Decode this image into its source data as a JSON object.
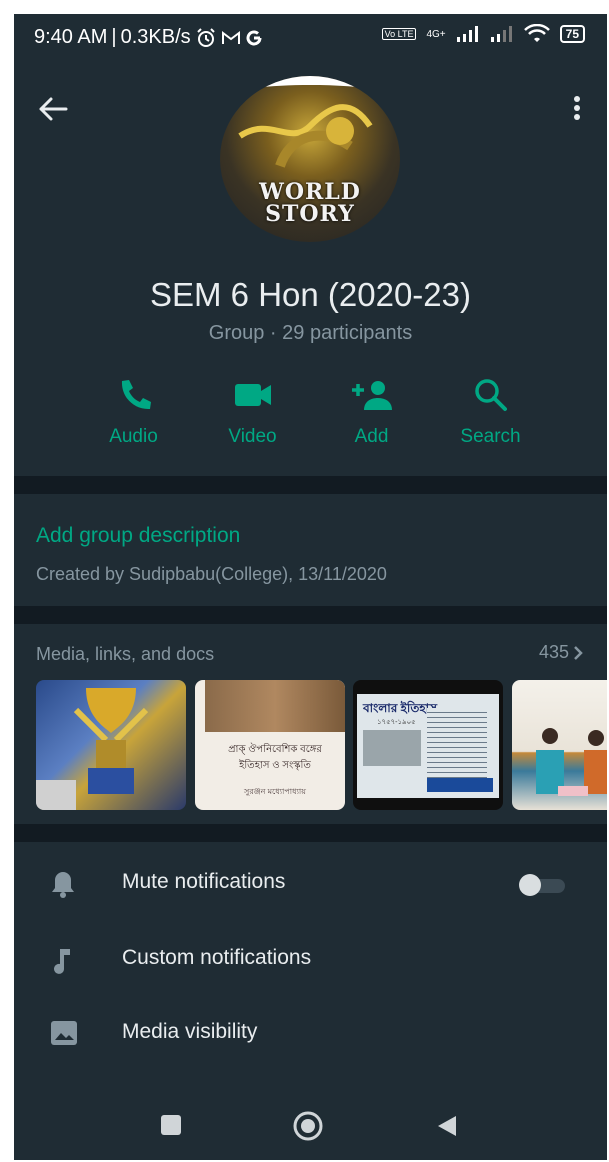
{
  "status_bar": {
    "time": "9:40 AM",
    "separator": "|",
    "speed": "0.3KB/s",
    "network_label": "4G+",
    "volte_label": "Vo LTE",
    "battery": "75"
  },
  "group": {
    "avatar_text_line1": "WORLD",
    "avatar_text_line2": "STORY",
    "name": "SEM 6 Hon (2020-23)",
    "subtitle": "Group · 29 participants"
  },
  "actions": [
    {
      "label": "Audio",
      "icon": "phone-icon"
    },
    {
      "label": "Video",
      "icon": "video-camera-icon"
    },
    {
      "label": "Add",
      "icon": "add-person-icon"
    },
    {
      "label": "Search",
      "icon": "search-icon"
    }
  ],
  "description": {
    "add_label": "Add group description",
    "created": "Created by Sudipbabu(College), 13/11/2020"
  },
  "media": {
    "title": "Media, links, and docs",
    "count": "435",
    "thumb2_title_line1": "প্রাক্‌ ঔপনিবেশিক বঙ্গের",
    "thumb2_title_line2": "ইতিহাস ও সংস্কৃতি",
    "thumb2_author": "সুরঞ্জন মধ্যোপাধ্যায়",
    "thumb3_title": "বাংলার ইতিহাস",
    "thumb3_years": "১৭৫৭-১৯০৫"
  },
  "settings": [
    {
      "label": "Mute notifications",
      "icon": "bell-icon"
    },
    {
      "label": "Custom notifications",
      "icon": "music-note-icon"
    },
    {
      "label": "Media visibility",
      "icon": "image-icon"
    }
  ],
  "colors": {
    "accent": "#00a884",
    "background": "#121b22",
    "panel": "#1f2c34",
    "secondary_text": "#8696a0"
  }
}
